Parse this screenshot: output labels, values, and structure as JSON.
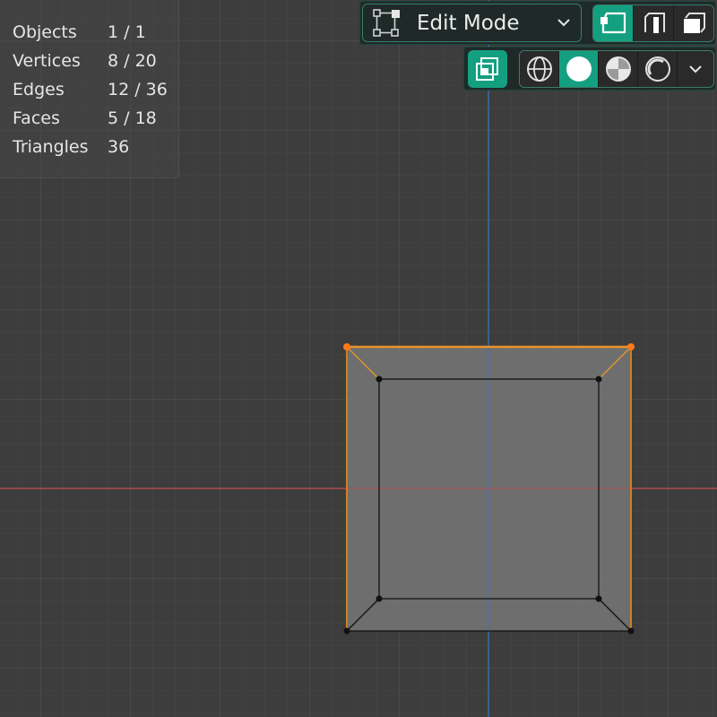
{
  "stats": [
    {
      "label": "Objects",
      "value": "1 / 1"
    },
    {
      "label": "Vertices",
      "value": "8 / 20"
    },
    {
      "label": "Edges",
      "value": "12 / 36"
    },
    {
      "label": "Faces",
      "value": "5 / 18"
    },
    {
      "label": "Triangles",
      "value": "36"
    }
  ],
  "header": {
    "mode_label": "Edit Mode",
    "mode_icon": "edit-mode-icon",
    "select_modes": [
      "vertex-select-icon",
      "edge-select-icon",
      "face-select-icon"
    ],
    "active_select_mode": "vertex"
  },
  "shading": {
    "overlay_icon": "xray-toggle-icon",
    "modes": [
      "wireframe-icon",
      "solid-icon",
      "material-preview-icon",
      "rendered-icon"
    ],
    "active_mode": "solid",
    "dropdown_icon": "chevron-down-icon"
  },
  "colors": {
    "background": "#3d3d3d",
    "grid_minor": "#474747",
    "grid_major": "#555555",
    "x_axis": "#b04a4a",
    "y_axis": "#3c6fb0",
    "face": "#777777",
    "selected_edge": "#e8942a",
    "accent": "#14a080"
  }
}
